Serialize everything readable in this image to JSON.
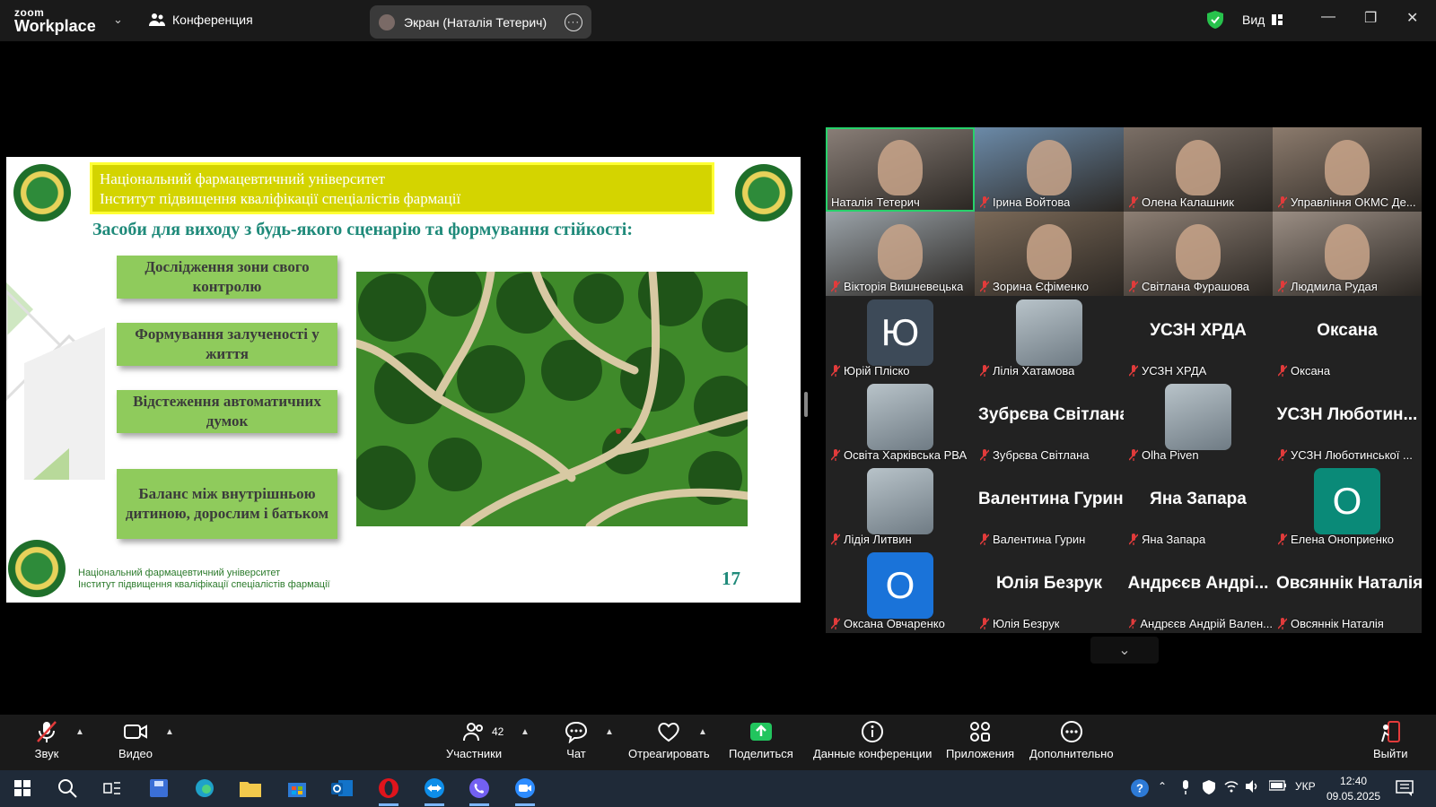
{
  "titlebar": {
    "logo_top": "zoom",
    "logo_bottom": "Workplace",
    "conference_label": "Конференция",
    "screen_share_label": "Экран (Наталія Тетерич)",
    "view_label": "Вид"
  },
  "slide": {
    "banner_line1": "Національний фармацевтичний університет",
    "banner_line2": "Інститут підвищення кваліфікації спеціалістів фармації",
    "heading": "Засоби для виходу з будь-якого сценарію та формування стійкості:",
    "boxes": [
      "Дослідження зони свого контролю",
      "Формування залученості у життя",
      "Відстеження автоматичних думок",
      "Баланс між внутрішньою дитиною, дорослим і батьком"
    ],
    "footer_line1": "Національний фармацевтичний університет",
    "footer_line2": "Інститут підвищення кваліфікації спеціалістів фармації",
    "page_number": "17"
  },
  "participants": [
    {
      "name": "Наталія Тетерич",
      "type": "video",
      "active": true
    },
    {
      "name": "Ірина Войтова",
      "type": "video"
    },
    {
      "name": "Олена Калашник",
      "type": "video"
    },
    {
      "name": "Управління ОКМС Де...",
      "type": "video"
    },
    {
      "name": "Вікторія Вишневецька",
      "type": "video"
    },
    {
      "name": "Зорина  Єфіменко",
      "type": "video"
    },
    {
      "name": "Світлана Фурашова",
      "type": "video"
    },
    {
      "name": "Людмила Рудая",
      "type": "video"
    },
    {
      "name": "Юрій Пліско",
      "type": "letter",
      "letter": "Ю",
      "color": "#3d4a58"
    },
    {
      "name": "Лілія Хатамова",
      "type": "photo"
    },
    {
      "name": "УСЗН ХРДА",
      "type": "text",
      "big": "УСЗН ХРДА"
    },
    {
      "name": "Оксана",
      "type": "text",
      "big": "Оксана"
    },
    {
      "name": "Освіта Харківська РВА",
      "type": "photo"
    },
    {
      "name": "Зубрєва Світлана",
      "type": "text",
      "big": "Зубрєва Світлана"
    },
    {
      "name": "Olha Piven",
      "type": "photo"
    },
    {
      "name": "УСЗН Люботинської ...",
      "type": "text",
      "big": "УСЗН Любо­тин..."
    },
    {
      "name": "Лідія Литвин",
      "type": "photo"
    },
    {
      "name": "Валентина Гурин",
      "type": "text",
      "big": "Валентина Гурин"
    },
    {
      "name": "Яна Запара",
      "type": "text",
      "big": "Яна Запара"
    },
    {
      "name": "Елена Оноприенко",
      "type": "letter",
      "letter": "О",
      "color": "#0a8a78"
    },
    {
      "name": "Оксана Овчаренко",
      "type": "letter",
      "letter": "О",
      "color": "#1a73d9"
    },
    {
      "name": "Юлія Безрук",
      "type": "text",
      "big": "Юлія Безрук"
    },
    {
      "name": "Андрєєв Андрій Вален...",
      "type": "text",
      "big": "Андрєєв Андрі..."
    },
    {
      "name": "Овсяннік Наталія",
      "type": "text",
      "big": "Овсяннік Наталія"
    }
  ],
  "toolbar": {
    "audio": "Звук",
    "video": "Видео",
    "participants": "Участники",
    "participants_count": "42",
    "chat": "Чат",
    "react": "Отреагировать",
    "share": "Поделиться",
    "info": "Данные конференции",
    "apps": "Приложения",
    "more": "Дополнительно",
    "leave": "Выйти"
  },
  "taskbar": {
    "language": "УКР",
    "time": "12:40",
    "date": "09.05.2025"
  }
}
